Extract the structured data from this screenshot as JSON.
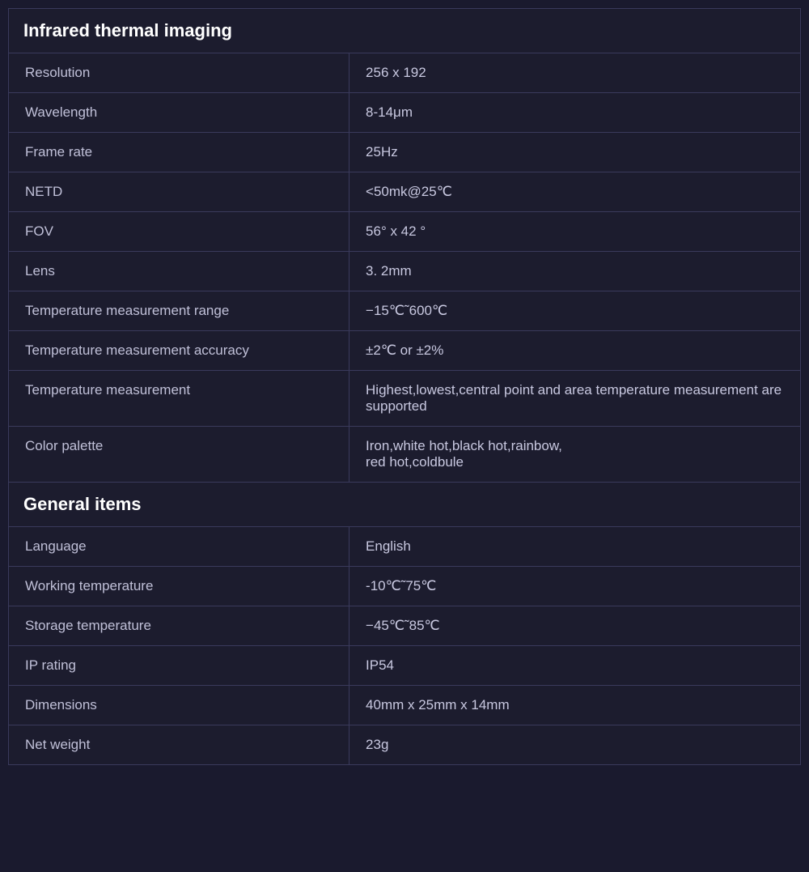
{
  "sections": [
    {
      "id": "infrared",
      "header": "Infrared thermal imaging",
      "rows": [
        {
          "label": "Resolution",
          "value": "256 x 192"
        },
        {
          "label": "Wavelength",
          "value": "8-14μm"
        },
        {
          "label": "Frame rate",
          "value": "25Hz"
        },
        {
          "label": "NETD",
          "value": "<50mk@25℃"
        },
        {
          "label": "FOV",
          "value": "56°  x  42  °"
        },
        {
          "label": "Lens",
          "value": "3. 2mm"
        },
        {
          "label": "Temperature measurement range",
          "value": "−15℃˜600℃"
        },
        {
          "label": "Temperature measurement accuracy",
          "value": "±2℃  or  ±2%"
        },
        {
          "label": "Temperature measurement",
          "value": "Highest,lowest,central point and area temperature measurement are supported"
        },
        {
          "label": "Color palette",
          "value": "Iron,white hot,black hot,rainbow,\nred hot,coldbule"
        }
      ]
    },
    {
      "id": "general",
      "header": "General items",
      "rows": [
        {
          "label": "Language",
          "value": "English"
        },
        {
          "label": "Working temperature",
          "value": "-10℃˜75℃"
        },
        {
          "label": "Storage temperature",
          "value": "−45℃˜85℃"
        },
        {
          "label": "IP rating",
          "value": "IP54"
        },
        {
          "label": "Dimensions",
          "value": "40mm  x  25mm  x  14mm"
        },
        {
          "label": "Net weight",
          "value": "23g"
        }
      ]
    }
  ]
}
